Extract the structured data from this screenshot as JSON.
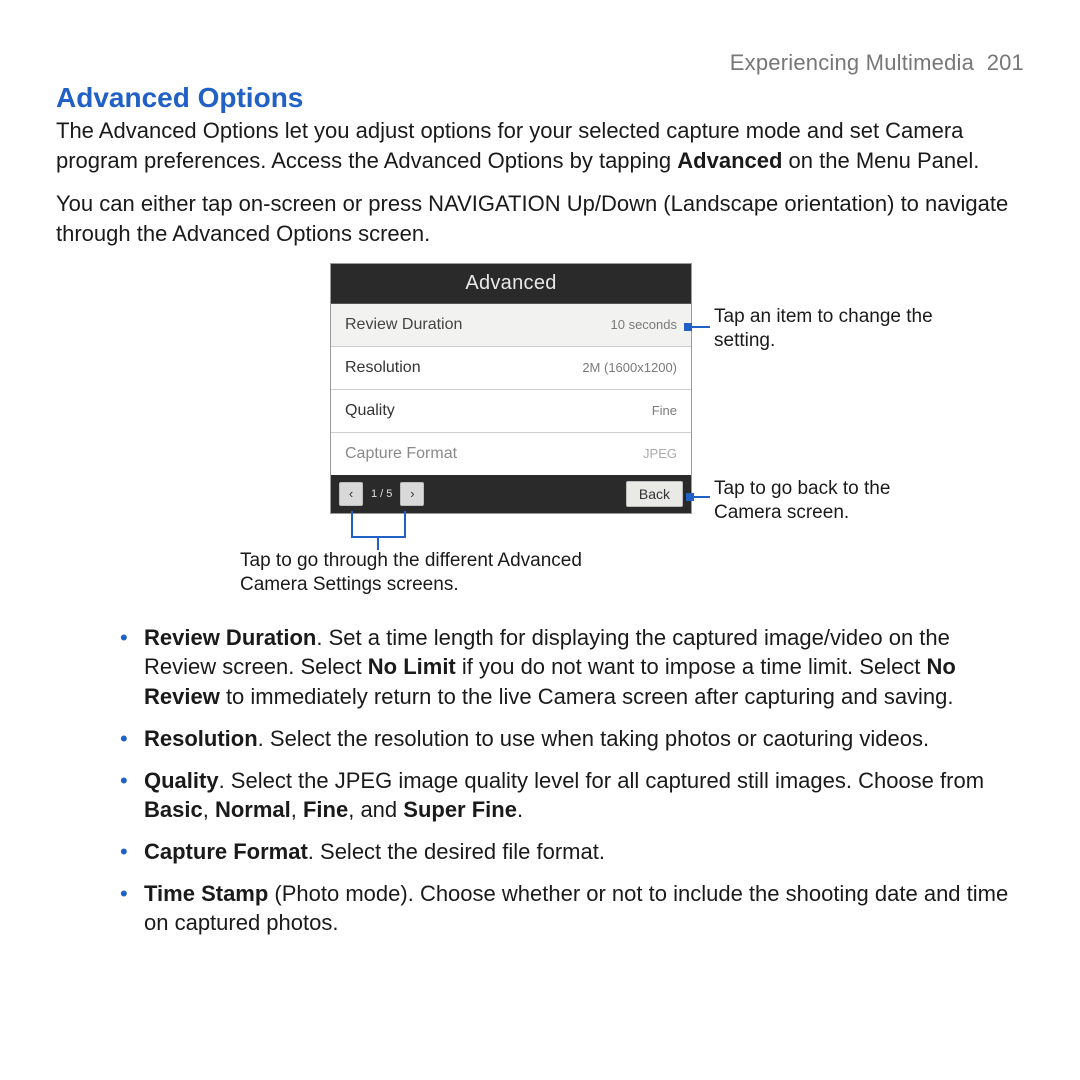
{
  "header": {
    "chapter": "Experiencing Multimedia",
    "page_no": "201"
  },
  "section": {
    "title": "Advanced Options",
    "para1_a": "The Advanced Options let you adjust options for your selected capture mode and set Camera program preferences. Access the Advanced Options by tapping ",
    "para1_bold": "Advanced",
    "para1_b": " on the Menu Panel.",
    "para2": "You can either tap on-screen or press NAVIGATION Up/Down (Landscape orientation) to navigate through the Advanced Options screen."
  },
  "device": {
    "title": "Advanced",
    "rows": [
      {
        "label": "Review Duration",
        "value": "10 seconds"
      },
      {
        "label": "Resolution",
        "value": "2M (1600x1200)"
      },
      {
        "label": "Quality",
        "value": "Fine"
      },
      {
        "label": "Capture Format",
        "value": "JPEG"
      }
    ],
    "footer": {
      "prev_glyph": "‹",
      "pager": "1 / 5",
      "next_glyph": "›",
      "back": "Back"
    }
  },
  "callouts": {
    "top_right": "Tap an item to change the setting.",
    "bottom_right": "Tap to go back to the Camera screen.",
    "bottom_left": "Tap to go through the different Advanced Camera Settings screens."
  },
  "bullets": {
    "review": {
      "bold": "Review Duration",
      "a": ". Set a time length for displaying the captured image/video on the Review screen. Select ",
      "b1": "No Limit",
      "c": " if you do not want to impose a time limit. Select ",
      "b2": "No Review",
      "d": " to immediately return to the live Camera screen after capturing and saving."
    },
    "resolution": {
      "bold": "Resolution",
      "text": ". Select the resolution to use when taking photos or caoturing videos."
    },
    "quality": {
      "bold": "Quality",
      "a": ". Select the JPEG image quality level for all captured still images. Choose from ",
      "b1": "Basic",
      "s1": ", ",
      "b2": "Normal",
      "s2": ", ",
      "b3": "Fine",
      "s3": ", and ",
      "b4": "Super Fine",
      "s4": "."
    },
    "capture": {
      "bold": "Capture Format",
      "text": ". Select the desired file format."
    },
    "timestamp": {
      "bold": "Time Stamp",
      "text": " (Photo mode). Choose whether or not to include the shooting date and time on captured photos."
    }
  }
}
